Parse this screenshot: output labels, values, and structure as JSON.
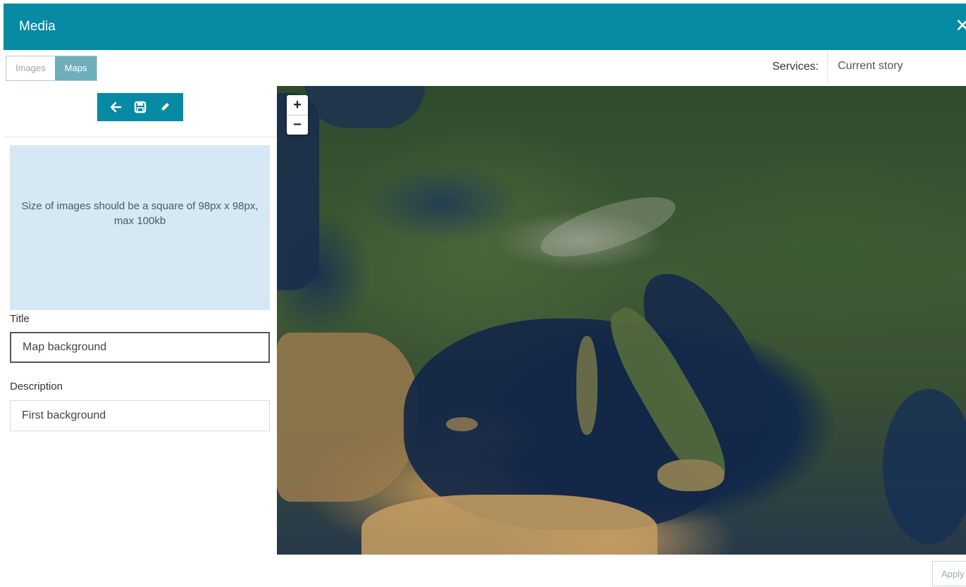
{
  "header": {
    "title": "Media",
    "close_icon": "close-icon"
  },
  "tabs": [
    {
      "label": "Images",
      "active": false
    },
    {
      "label": "Maps",
      "active": true
    }
  ],
  "services": {
    "label": "Services:",
    "selected": "Current story"
  },
  "toolbar": {
    "icons": [
      "arrow-left-icon",
      "save-icon",
      "pencil-icon"
    ]
  },
  "dropzone": {
    "text": "Size of images should be a square of 98px x 98px, max 100kb"
  },
  "form": {
    "title_label": "Title",
    "title_value": "Map background",
    "description_label": "Description",
    "description_value": "First background"
  },
  "map": {
    "zoom_in": "+",
    "zoom_out": "−"
  },
  "footer": {
    "apply_label": "Apply"
  },
  "colors": {
    "accent": "#078aa3",
    "tab_active": "#6faebb",
    "dropzone_bg": "#d6e8f3"
  }
}
